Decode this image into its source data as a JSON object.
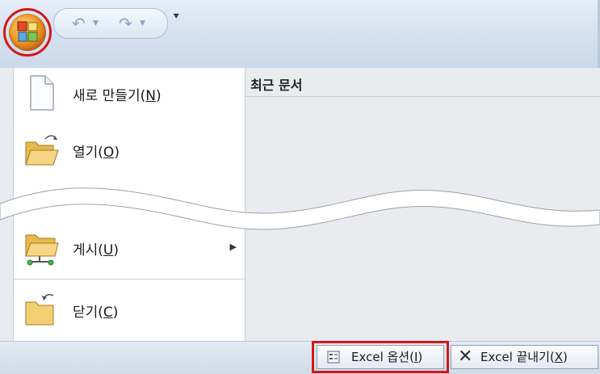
{
  "menu": {
    "items": [
      {
        "label": "새로 만들기",
        "key": "N"
      },
      {
        "label": "열기",
        "key": "O"
      },
      {
        "label": "게시",
        "key": "U"
      },
      {
        "label": "닫기",
        "key": "C"
      }
    ]
  },
  "recent": {
    "title": "최근 문서"
  },
  "footer": {
    "options_label": "Excel 옵션",
    "options_key": "I",
    "exit_label": "Excel 끝내기",
    "exit_key": "X"
  },
  "icons": {
    "office": "office-button-icon",
    "undo": "undo-icon",
    "redo": "redo-icon",
    "customize": "customize-toolbar-icon",
    "new": "blank-document-icon",
    "open": "open-folder-icon",
    "publish": "publish-folder-icon",
    "close": "close-folder-icon",
    "options": "options-icon",
    "exit": "close-x-icon"
  },
  "colors": {
    "highlight": "#d21818",
    "accent": "#f29a2a"
  }
}
